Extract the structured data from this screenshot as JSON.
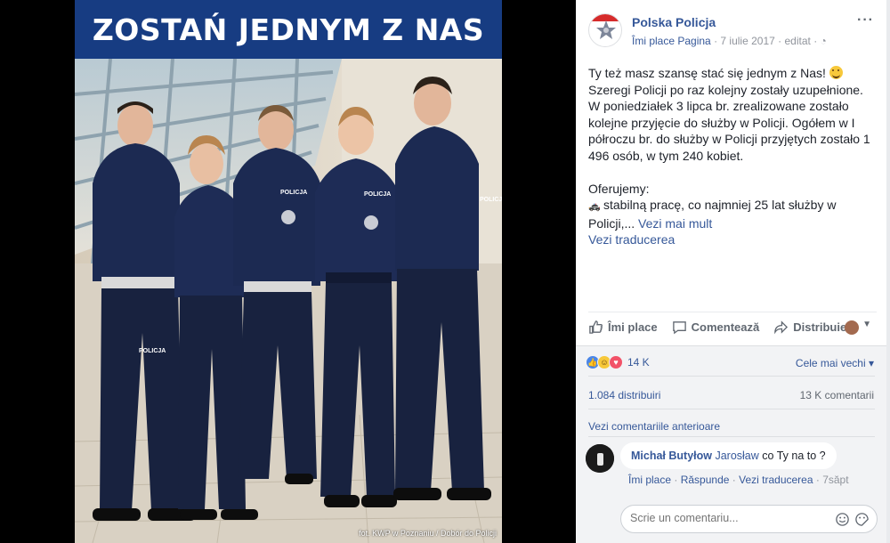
{
  "photo": {
    "banner_text": "ZOSTAŃ JEDNYM Z NAS",
    "credit": "fot. KWP w Poznaniu / Dobór do Policji",
    "badge_text": "POLICJA",
    "colors": {
      "banner": "#173c82",
      "uniform": "#1c2a52",
      "floor": "#d7d0c2"
    }
  },
  "post": {
    "page_name": "Polska Policja",
    "like_page": "Îmi place Pagina",
    "date": "7 iulie 2017",
    "edited": "editat",
    "body_line1": "Ty też masz szansę stać się jednym z Nas!",
    "body_para1": "Szeregi Policji po raz kolejny zostały uzupełnione. W poniedziałek 3 lipca br. zrealizowane zostało kolejne przyjęcie do służby w Policji. Ogółem w I półroczu br. do służby w Policji przyjętych zostało 1 496 osób, w tym 240 kobiet.",
    "offer_heading": "Oferujemy:",
    "offer_item": "stabilną pracę, co najmniej 25 lat służby w Policji,...",
    "see_more": "Vezi mai mult",
    "see_translation": "Vezi traducerea"
  },
  "actions": {
    "like": "Îmi place",
    "comment": "Comentează",
    "share": "Distribuie"
  },
  "stats": {
    "reactions": "14 K",
    "sort": "Cele mai vechi",
    "shares": "1.084 distribuiri",
    "comments": "13 K comentarii",
    "previous_comments": "Vezi comentariile anterioare"
  },
  "comment": {
    "author": "Michał Butyłow",
    "mention": "Jarosław",
    "text": "co Ty na to ?",
    "like": "Îmi place",
    "reply": "Răspunde",
    "translate": "Vezi traducerea",
    "time": "7săpt"
  },
  "composer": {
    "placeholder": "Scrie un comentariu..."
  }
}
